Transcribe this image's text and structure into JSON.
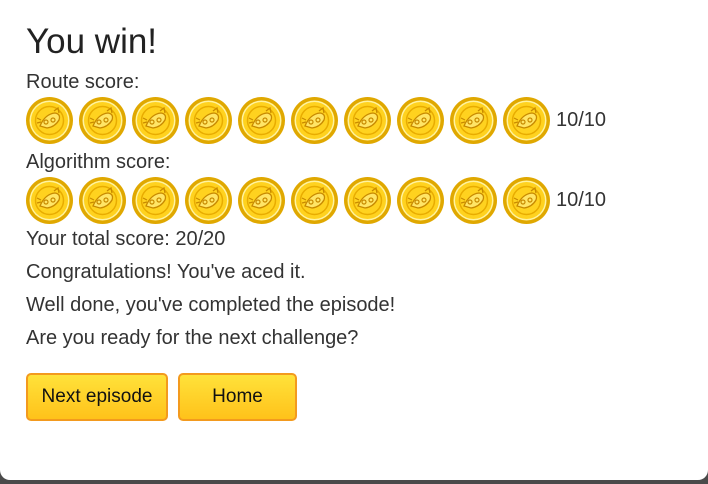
{
  "dialog": {
    "title": "You win!",
    "route": {
      "label": "Route score:",
      "score": "10/10",
      "earned": 10,
      "max": 10
    },
    "algorithm": {
      "label": "Algorithm score:",
      "score": "10/10",
      "earned": 10,
      "max": 10
    },
    "total": "Your total score: 20/20",
    "messages": [
      "Congratulations! You've aced it.",
      "Well done, you've completed the episode!",
      "Are you ready for the next challenge?"
    ],
    "buttons": {
      "next": "Next episode",
      "home": "Home"
    }
  },
  "coin_icon": "gold-coin-icon",
  "colors": {
    "coin_rim": "#e0a800",
    "coin_face": "#ffd21f",
    "button_fill": "#ffd42a",
    "button_border": "#f39a1e"
  }
}
